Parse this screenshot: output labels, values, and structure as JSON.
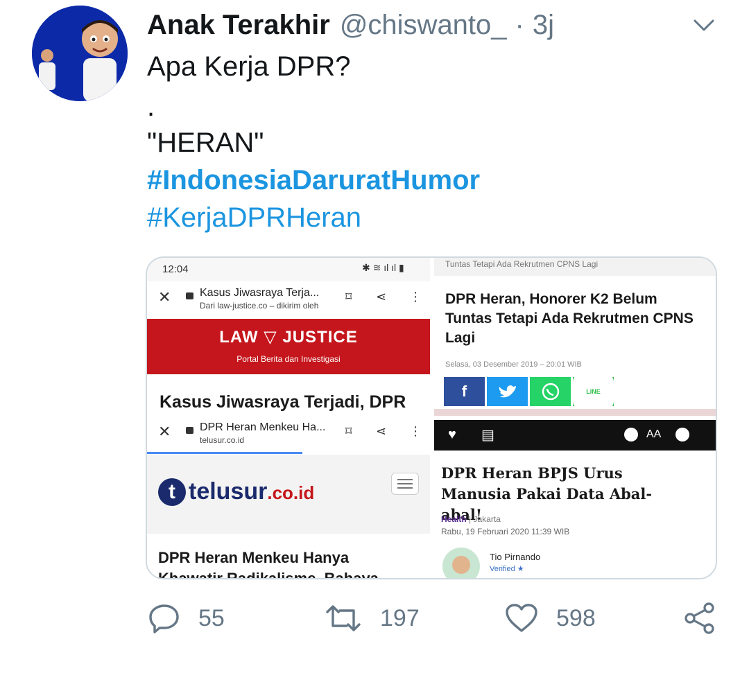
{
  "tweet": {
    "display_name": "Anak Terakhir",
    "handle": "@chiswanto_",
    "separator": "·",
    "time": "3j",
    "text_line1": "Apa Kerja DPR?",
    "text_line2": ".",
    "text_line3": "\"HERAN\"",
    "hashtag1": "#IndonesiaDaruratHumor",
    "hashtag2": "#KerjaDPRHeran",
    "link_color": "#1b95e0"
  },
  "media": {
    "top_left": {
      "status_time": "12:04",
      "tab_title": "Kasus Jiwasraya Terja...",
      "tab_subtitle": "Dari law-justice.co – dikirim oleh",
      "logo": "LAW ▽ JUSTICE",
      "tagline": "Portal Berita dan Investigasi",
      "headline": "Kasus Jiwasraya Terjadi, DPR"
    },
    "bottom_left": {
      "tab_title": "DPR Heran Menkeu Ha...",
      "tab_subtitle": "telusur.co.id",
      "logo_main": "telusur",
      "logo_suffix": ".co.id",
      "headline": "DPR Heran Menkeu Hanya",
      "headline_cut": "Khawatir Radikalisme, Bahaya"
    },
    "top_right": {
      "breadcrumb": "Tuntas Tetapi Ada Rekrutmen CPNS Lagi",
      "headline": "DPR Heran, Honorer K2 Belum Tuntas Tetapi Ada Rekrutmen CPNS Lagi",
      "date": "Selasa, 03 Desember 2019 – 20:01 WIB",
      "share_f": "f",
      "share_line": "LINE"
    },
    "bottom_right": {
      "font_label": "AA",
      "headline": "DPR Heran BPJS Urus Manusia Pakai Data Abal-abal!",
      "category": "Health",
      "location": "| Jakarta",
      "date": "Rabu, 19 Februari 2020 11:39 WIB",
      "author": "Tio Pirnando",
      "verified": "Verified ★"
    }
  },
  "actions": {
    "reply_count": "55",
    "retweet_count": "197",
    "like_count": "598"
  },
  "icons": [
    "chevron-down-icon",
    "reply-icon",
    "retweet-icon",
    "like-icon",
    "share-icon"
  ]
}
